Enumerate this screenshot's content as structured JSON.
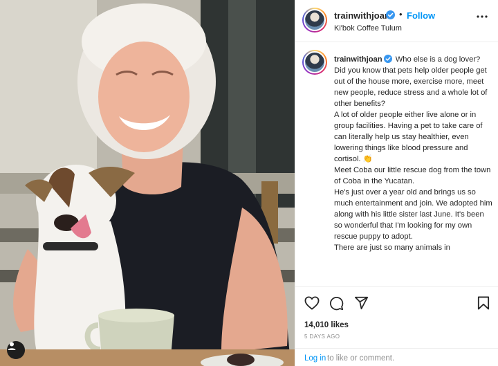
{
  "post": {
    "username": "trainwithjoan",
    "follow_label": "Follow",
    "dot": "•",
    "location": "Ki'bok Coffee Tulum",
    "caption": {
      "username": "trainwithjoan",
      "text": "Who else is a dog lover?\nDid you know that pets help older people get out of the house more, exercise more, meet new people, reduce stress and a whole lot of other benefits?\nA lot of older people either live alone or in group facilities. Having a pet to take care of can literally help us stay healthier, even lowering things like blood pressure and cortisol. 👏\nMeet Coba our little rescue dog from the town of Coba in the Yucatan.\nHe's just over a year old and brings us so much entertainment and join. We adopted him along with his little sister last June. It's been so wonderful that I'm looking for my own rescue puppy to adopt.\nThere are just so many animals in"
    },
    "likes": "14,010 likes",
    "date": "5 DAYS AGO",
    "login": {
      "link": "Log in",
      "rest": "to like or comment."
    }
  },
  "icons": {
    "verified": "verified-badge-icon",
    "more": "more-options-icon",
    "like": "heart-icon",
    "comment": "comment-icon",
    "share": "share-icon",
    "save": "bookmark-icon",
    "user_tag": "user-tag-icon"
  },
  "colors": {
    "link_blue": "#0095f6",
    "text": "#262626",
    "muted": "#8e8e8e",
    "verified_blue": "#3897f0"
  }
}
